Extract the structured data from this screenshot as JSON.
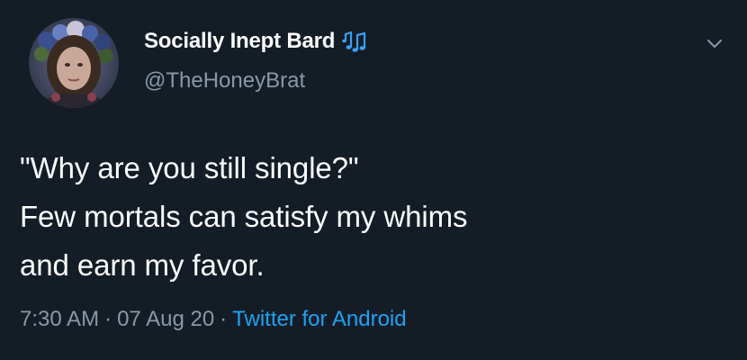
{
  "user": {
    "display_name": "Socially Inept Bard",
    "badge_icon": "music-notes-icon",
    "handle": "@TheHoneyBrat"
  },
  "tweet": {
    "lines": [
      "\"Why are you still single?\"",
      "Few mortals can satisfy my whims",
      "and earn my favor."
    ]
  },
  "meta": {
    "time": "7:30 AM",
    "separator": "·",
    "date": "07 Aug 20",
    "source": "Twitter for Android"
  },
  "colors": {
    "background": "#141d26",
    "text": "#ffffff",
    "secondary": "#8899a6",
    "accent": "#1da1f2"
  }
}
